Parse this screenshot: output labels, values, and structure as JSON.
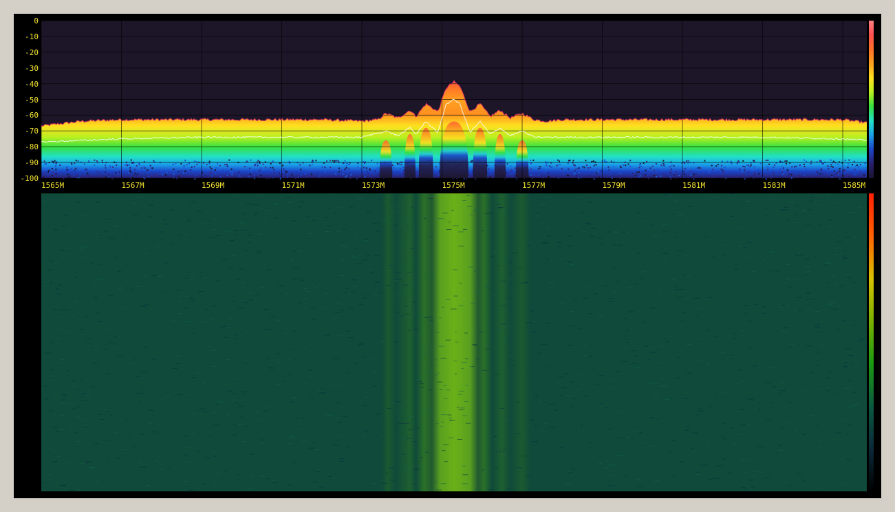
{
  "spectrum": {
    "y_axis_labels": [
      "0",
      "-10",
      "-20",
      "-30",
      "-40",
      "-50",
      "-60",
      "-70",
      "-80",
      "-90",
      "-100"
    ],
    "x_axis_labels": [
      "1565M",
      "1567M",
      "1569M",
      "1571M",
      "1573M",
      "1575M",
      "1577M",
      "1579M",
      "1581M",
      "1583M",
      "1585M"
    ],
    "palette": [
      "#1a1530",
      "#2a1f6e",
      "#1b44c8",
      "#1aa0e8",
      "#22e0c8",
      "#36e040",
      "#b8f020",
      "#ffe020",
      "#ffa020",
      "#ff7028",
      "#ff5050",
      "#ff8080"
    ],
    "background": "#1c1628",
    "label_color": "#f2e330"
  },
  "chart_data": {
    "type": "area",
    "x_unit": "MHz",
    "y_unit": "dB",
    "xlim": [
      1565,
      1585.6
    ],
    "ylim": [
      -100,
      0
    ],
    "x_ticks": [
      1565,
      1567,
      1569,
      1571,
      1573,
      1575,
      1577,
      1579,
      1581,
      1583,
      1585
    ],
    "y_ticks": [
      0,
      -10,
      -20,
      -30,
      -40,
      -50,
      -60,
      -70,
      -80,
      -90,
      -100
    ],
    "grid": true,
    "peak_envelope": {
      "x": [
        1565.0,
        1566.0,
        1567.0,
        1568.0,
        1569.0,
        1570.0,
        1571.0,
        1572.0,
        1573.0,
        1573.4,
        1573.6,
        1573.9,
        1574.2,
        1574.35,
        1574.6,
        1574.9,
        1575.1,
        1575.3,
        1575.45,
        1575.7,
        1575.95,
        1576.2,
        1576.45,
        1576.7,
        1577.0,
        1577.3,
        1577.6,
        1578.0,
        1579.0,
        1580.0,
        1581.0,
        1582.0,
        1583.0,
        1584.0,
        1585.0,
        1585.6
      ],
      "y": [
        -67,
        -64,
        -63,
        -63,
        -63,
        -63,
        -63,
        -63,
        -64,
        -63,
        -59,
        -62,
        -57,
        -61,
        -53,
        -58,
        -43,
        -39,
        -42,
        -58,
        -53,
        -61,
        -57,
        -62,
        -59,
        -63,
        -64,
        -63,
        -63,
        -63,
        -63,
        -63,
        -63,
        -63,
        -63,
        -65
      ]
    },
    "average_trace": {
      "x": [
        1565.0,
        1567.0,
        1569.0,
        1571.0,
        1573.0,
        1573.6,
        1573.9,
        1574.2,
        1574.35,
        1574.6,
        1574.9,
        1575.1,
        1575.3,
        1575.45,
        1575.7,
        1575.95,
        1576.2,
        1576.45,
        1576.7,
        1577.0,
        1577.3,
        1579.0,
        1581.0,
        1583.0,
        1585.0,
        1585.6
      ],
      "y": [
        -77,
        -75,
        -74,
        -74,
        -74,
        -70,
        -73,
        -68,
        -72,
        -64,
        -71,
        -53,
        -50,
        -53,
        -71,
        -64,
        -72,
        -68,
        -73,
        -70,
        -74,
        -74,
        -74,
        -74,
        -75,
        -76
      ]
    },
    "noise_floor": -92
  },
  "waterfall": {
    "colorbar_colors": [
      "#000000",
      "#0b2a3a",
      "#0a5a40",
      "#1a9a10",
      "#7ab000",
      "#d8c000",
      "#ff6000",
      "#ff2000"
    ],
    "background_color": "#0f4a3a",
    "signal_color": "#5aa020"
  }
}
